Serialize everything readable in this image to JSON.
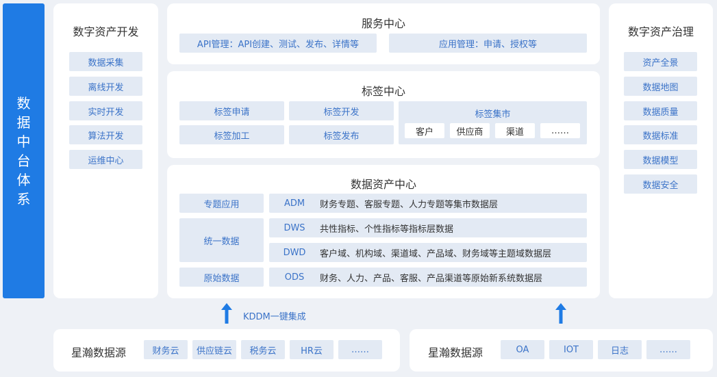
{
  "side_title_chars": [
    "数",
    "据",
    "中",
    "台",
    "体",
    "系"
  ],
  "left_panel": {
    "title": "数字资产开发",
    "items": [
      "数据采集",
      "离线开发",
      "实时开发",
      "算法开发",
      "运维中心"
    ]
  },
  "right_panel": {
    "title": "数字资产治理",
    "items": [
      "资产全景",
      "数据地图",
      "数据质量",
      "数据标准",
      "数据模型",
      "数据安全"
    ]
  },
  "service_center": {
    "title": "服务中心",
    "items": [
      "API管理：API创建、测试、发布、详情等",
      "应用管理：申请、授权等"
    ]
  },
  "tag_center": {
    "title": "标签中心",
    "items": [
      "标签申请",
      "标签开发",
      "标签加工",
      "标签发布"
    ],
    "market": {
      "title": "标签集市",
      "items": [
        "客户",
        "供应商",
        "渠道",
        "……"
      ]
    }
  },
  "asset_center": {
    "title": "数据资产中心",
    "groups": [
      "专题应用",
      "统一数据",
      "原始数据"
    ],
    "layers": [
      {
        "code": "ADM",
        "desc": "财务专题、客服专题、人力专题等集市数据层"
      },
      {
        "code": "DWS",
        "desc": "共性指标、个性指标等指标层数据"
      },
      {
        "code": "DWD",
        "desc": "客户域、机构域、渠道域、产品域、财务域等主题域数据层"
      },
      {
        "code": "ODS",
        "desc": "财务、人力、产品、客服、产品渠道等原始新系统数据层"
      }
    ]
  },
  "kddm_label": "KDDM一键集成",
  "source_left": {
    "title": "星瀚数据源",
    "items": [
      "财务云",
      "供应链云",
      "税务云",
      "HR云",
      "……"
    ]
  },
  "source_right": {
    "title": "星瀚数据源",
    "items": [
      "OA",
      "IOT",
      "日志",
      "……"
    ]
  },
  "colors": {
    "accent": "#1f7be4",
    "chip_bg": "#e3eaf4",
    "chip_text": "#3b73c8",
    "page_bg": "#eef1f6"
  }
}
